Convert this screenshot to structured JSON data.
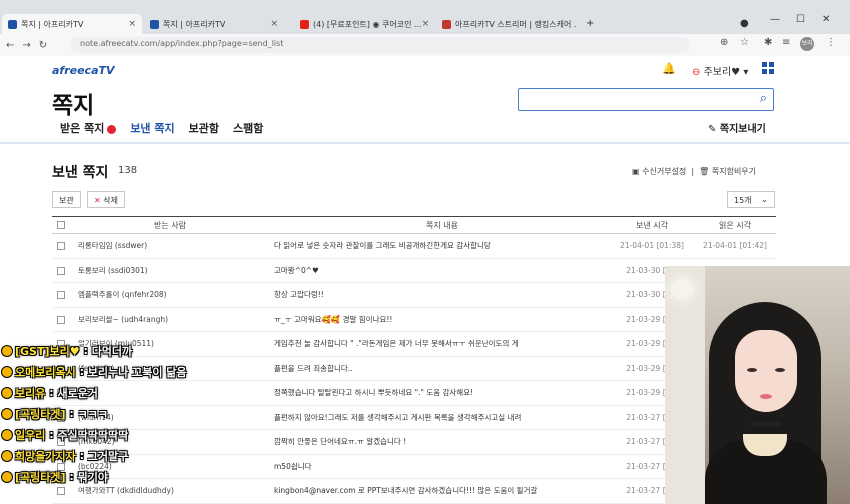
{
  "browser": {
    "tabs": [
      {
        "label": "쪽지 | 아프리카TV",
        "active": true,
        "fav_color": "#1f53a6"
      },
      {
        "label": "쪽지 | 아프리카TV",
        "active": false,
        "fav_color": "#1f53a6"
      },
      {
        "label": "(4) [무료포인트] ◉ 쿠어코인 ...",
        "active": false,
        "fav_color": "#e62117"
      },
      {
        "label": "아프리카TV 스트리머 | 랭킹스캐어 ...",
        "active": false,
        "fav_color": "#c0392b"
      }
    ],
    "new_tab": "+",
    "url": "note.afreecatv.com/app/index.php?page=send_list",
    "profile": "보리"
  },
  "header": {
    "logo": "afreecaTV",
    "user": "주보리♥",
    "bell_icon": "bell-icon",
    "apps_icon": "grid-icon"
  },
  "page": {
    "title": "쪽지",
    "search": {
      "placeholder": "",
      "value": ""
    },
    "tabs": [
      {
        "label": "받은 쪽지",
        "badge": true,
        "active": false
      },
      {
        "label": "보낸 쪽지",
        "badge": false,
        "active": true
      },
      {
        "label": "보관함",
        "badge": false,
        "active": false
      },
      {
        "label": "스팸함",
        "badge": false,
        "active": false
      }
    ],
    "send_button": "쪽지보내기"
  },
  "list": {
    "title": "보낸 쪽지",
    "count": "138",
    "links": [
      "수신거부설정",
      "쪽지함비우기"
    ],
    "actions": {
      "keep": "보관",
      "delete": "삭제"
    },
    "page_size": "15개",
    "columns": [
      "받는 사람",
      "쪽지 내용",
      "보낸 시각",
      "읽은 시각"
    ],
    "rows": [
      {
        "to": "리롱타임임 (ssdwer)",
        "msg": "다 읽어로 넣은 숫자라 관찰이를 그래도 비공개하긴한게요 감사합니당",
        "sent": "21-04-01 [01:38]",
        "read": "21-04-01 [01:42]"
      },
      {
        "to": "토롱보리 (ssdi0301)",
        "msg": "고마봥^0^♥",
        "sent": "21-03-30 [00:",
        "read": ""
      },
      {
        "to": "엠플랙주롤이 (qnfehr208)",
        "msg": "항상 고맙다렁!!",
        "sent": "21-03-30 [02:",
        "read": ""
      },
      {
        "to": "보리보리쌀~ (udh4rangh)",
        "msg": "ㅠ_ㅜ 고마워요🥰🥰 경말 힘이나요!!",
        "sent": "21-03-29 [22:",
        "read": ""
      },
      {
        "to": "얼기러보이 (mlu0511)",
        "msg": "게임추천 놀 감사합니다 \" .\"라돈게임은 제가 너무 못해서ㅠㅜ 쉬운난이도의 게",
        "sent": "21-03-29 [17:",
        "read": ""
      },
      {
        "to": "(fenkintv)",
        "msg": "플펀을 드려 죄송합니다..",
        "sent": "21-03-29 [17:",
        "read": ""
      },
      {
        "to": "",
        "msg": "정쪽했습니다 탈탈왼다고 하시니 뿌듯하네요 \".\" 도움 감사해요!",
        "sent": "21-03-29 [01:",
        "read": ""
      },
      {
        "to": "(widm14)",
        "msg": "플펀하지 않아요!그래도 저를 생각해주시고 게시판 목록을 생각해주시고실 내려",
        "sent": "21-03-27 [16:",
        "read": ""
      },
      {
        "to": "(mk6042)",
        "msg": "깜짝히 안좋은 단어네요ㅠ.ㅠ 알겠습니다 !",
        "sent": "21-03-27 [15:",
        "read": ""
      },
      {
        "to": "(bc0224)",
        "msg": "m50쉽니다",
        "sent": "21-03-27 [15:",
        "read": ""
      },
      {
        "to": "여행가와TT (dkdidldudhdy)",
        "msg": "kingbon4@naver.com 로 PPT보내주시면 감사하겠습니다!!! 많은 도움이 될거갈",
        "sent": "21-03-27 [15:",
        "read": ""
      }
    ]
  },
  "chat": [
    {
      "nick": "[GST]보리♥",
      "msg": "다먹더까"
    },
    {
      "nick": "오메보리옥시",
      "msg": "보리누나 꼬북이 닮음"
    },
    {
      "nick": "보리유",
      "msg": "새로운거"
    },
    {
      "nick": "[곡링타겟]",
      "msg": "ㅋㅋㅋ"
    },
    {
      "nick": "일우리",
      "msg": "주실딱딱딱딱딱"
    },
    {
      "nick": "희망을가지자",
      "msg": "그거말구"
    },
    {
      "nick": "[곡링타겟]",
      "msg": "뭐기야"
    }
  ]
}
